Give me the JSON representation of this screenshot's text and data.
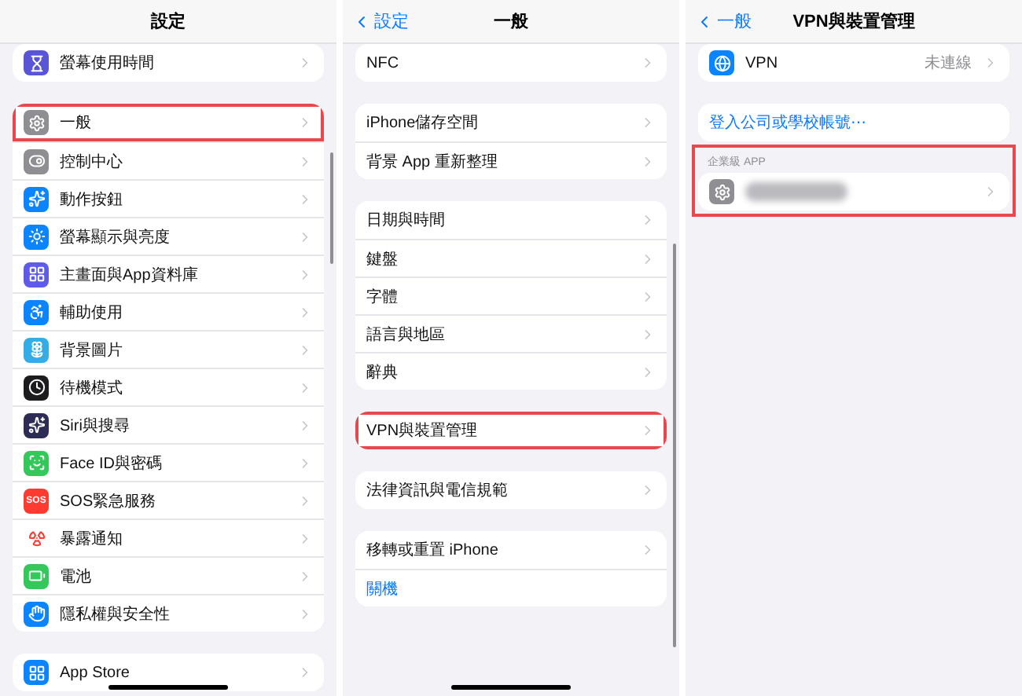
{
  "panels": [
    {
      "title": "設定",
      "sections": [
        {
          "rows": [
            {
              "label": "螢幕使用時間",
              "kind": "hourglass",
              "color": "#5856d6",
              "highlighted": false
            }
          ]
        },
        {
          "rows": [
            {
              "label": "一般",
              "kind": "gear",
              "color": "#8e8e93",
              "highlighted": true
            },
            {
              "label": "控制中心",
              "kind": "toggles",
              "color": "#8e8e93",
              "highlighted": false
            },
            {
              "label": "動作按鈕",
              "kind": "action",
              "color": "#0a84ff",
              "highlighted": false
            },
            {
              "label": "螢幕顯示與亮度",
              "kind": "sun",
              "color": "#0a84ff",
              "highlighted": false
            },
            {
              "label": "主畫面與App資料庫",
              "kind": "grid",
              "color": "#5e5ce6",
              "highlighted": false
            },
            {
              "label": "輔助使用",
              "kind": "person",
              "color": "#0a84ff",
              "highlighted": false
            },
            {
              "label": "背景圖片",
              "kind": "flower",
              "color": "#32ade6",
              "highlighted": false
            },
            {
              "label": "待機模式",
              "kind": "standby",
              "color": "#1c1c1e",
              "highlighted": false
            },
            {
              "label": "Siri與搜尋",
              "kind": "siri",
              "color": "#2c2c54",
              "highlighted": false
            },
            {
              "label": "Face ID與密碼",
              "kind": "face",
              "color": "#34c759",
              "highlighted": false
            },
            {
              "label": "SOS緊急服務",
              "kind": "badge",
              "badge": "SOS",
              "color": "#ff3b30",
              "highlighted": false
            },
            {
              "label": "暴露通知",
              "kind": "virus",
              "color": "#ffffff",
              "highlighted": false
            },
            {
              "label": "電池",
              "kind": "battery",
              "color": "#34c759",
              "highlighted": false
            },
            {
              "label": "隱私權與安全性",
              "kind": "hand",
              "color": "#0a84ff",
              "highlighted": false
            }
          ]
        },
        {
          "rows": [
            {
              "label": "App Store",
              "kind": "appstore",
              "color": "#0a84ff",
              "highlighted": false
            }
          ]
        }
      ]
    },
    {
      "title": "一般",
      "back": "設定",
      "sections": [
        {
          "rows": [
            {
              "label": "NFC",
              "highlighted": false
            }
          ]
        },
        {
          "rows": [
            {
              "label": "iPhone儲存空間",
              "highlighted": false
            },
            {
              "label": "背景 App 重新整理",
              "highlighted": false
            }
          ]
        },
        {
          "rows": [
            {
              "label": "日期與時間",
              "highlighted": false
            },
            {
              "label": "鍵盤",
              "highlighted": false
            },
            {
              "label": "字體",
              "highlighted": false
            },
            {
              "label": "語言與地區",
              "highlighted": false
            },
            {
              "label": "辭典",
              "highlighted": false
            }
          ]
        },
        {
          "rows": [
            {
              "label": "VPN與裝置管理",
              "highlighted": true
            }
          ]
        },
        {
          "rows": [
            {
              "label": "法律資訊與電信規範",
              "highlighted": false
            }
          ]
        },
        {
          "rows": [
            {
              "label": "移轉或重置 iPhone",
              "highlighted": false
            },
            {
              "label": "關機",
              "kind": "link",
              "highlighted": false
            }
          ]
        }
      ]
    },
    {
      "title": "VPN與裝置管理",
      "back": "一般",
      "sections": [
        {
          "rows": [
            {
              "label": "VPN",
              "value": "未連線",
              "kind": "globe",
              "color": "#0a84ff",
              "highlighted": false
            }
          ]
        },
        {
          "rows": [
            {
              "label": "登入公司或學校帳號⋯",
              "kind": "link",
              "highlighted": false
            }
          ]
        },
        {
          "header": "企業級 APP",
          "highlighted": true,
          "rows": [
            {
              "kind": "gear",
              "color": "#8e8e93",
              "redacted": true,
              "highlighted": false
            }
          ]
        }
      ]
    }
  ]
}
